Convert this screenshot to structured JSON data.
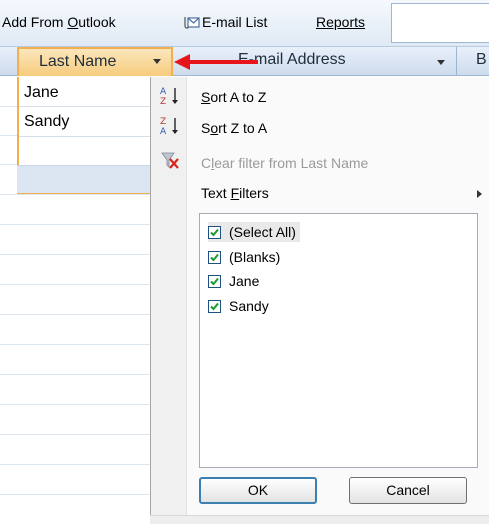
{
  "toolbar": {
    "add_from_outlook_prefix": "Add From ",
    "add_from_outlook_underlined": "O",
    "add_from_outlook_suffix": "utlook",
    "email_list_label": "E-mail List",
    "reports_label": "Reports",
    "email_icon": "envelope-clip-icon"
  },
  "header": {
    "last_name_label": "Last Name",
    "email_address_label": "E-mail Address",
    "next_column_label": "B",
    "filter_arrow_icon": "chevron-down-icon",
    "callout_icon": "red-arrow-icon"
  },
  "grid": {
    "cells": [
      "Jane",
      "Sandy"
    ]
  },
  "menu": {
    "sort_az_underlined": "S",
    "sort_az_rest": "ort A to Z",
    "sort_za_prefix": "S",
    "sort_za_underlined": "o",
    "sort_za_rest": "rt Z to A",
    "clear_filter_prefix": "C",
    "clear_filter_underlined": "l",
    "clear_filter_rest": "ear filter from Last Name",
    "text_filters_prefix": "Text ",
    "text_filters_underlined": "F",
    "text_filters_rest": "ilters",
    "icons": [
      "sort-ascending-icon",
      "sort-descending-icon",
      "clear-filter-icon",
      "submenu-arrow-icon"
    ]
  },
  "filter_list": {
    "items": [
      {
        "label": "(Select All)",
        "checked": true
      },
      {
        "label": "(Blanks)",
        "checked": true
      },
      {
        "label": "Jane",
        "checked": true
      },
      {
        "label": "Sandy",
        "checked": true
      }
    ]
  },
  "buttons": {
    "ok": "OK",
    "cancel": "Cancel"
  },
  "colors": {
    "header_highlight": "#f6cc7e",
    "selection_border": "#f3ae4d",
    "callout_arrow": "#e8141b",
    "checkbox_check": "#1f9a2e"
  }
}
